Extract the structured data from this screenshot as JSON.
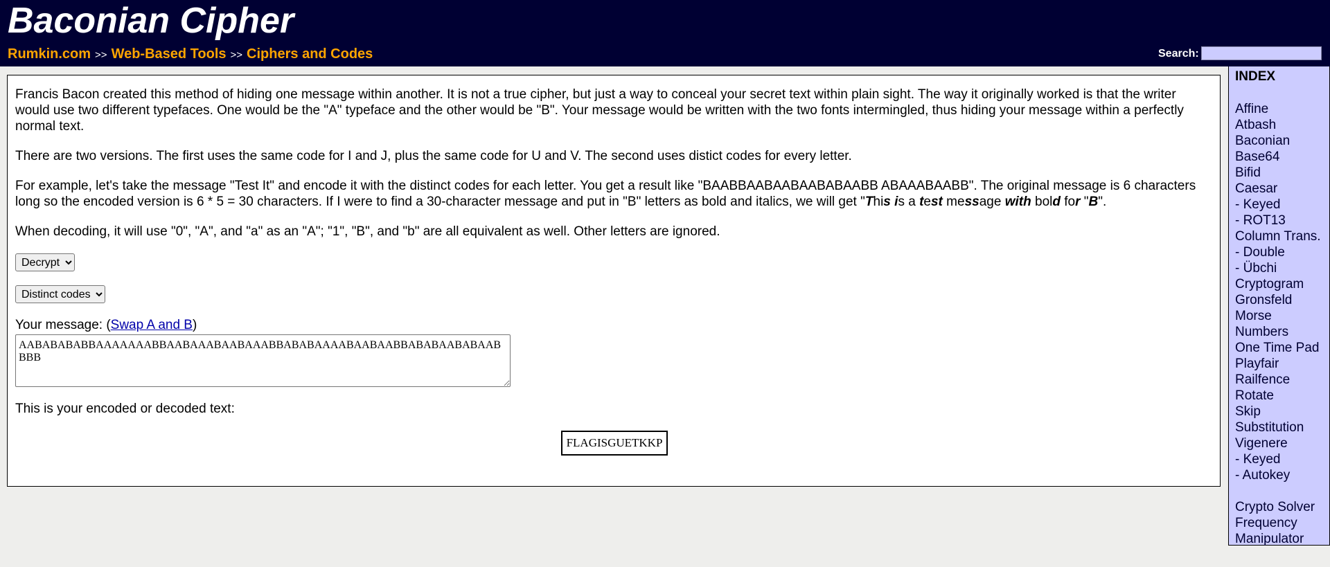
{
  "header": {
    "title": "Baconian Cipher",
    "breadcrumb": [
      "Rumkin.com",
      "Web-Based Tools",
      "Ciphers and Codes"
    ],
    "separator": ">>",
    "search_label": "Search:"
  },
  "content": {
    "para1": "Francis Bacon created this method of hiding one message within another. It is not a true cipher, but just a way to conceal your secret text within plain sight. The way it originally worked is that the writer would use two different typefaces. One would be the \"A\" typeface and the other would be \"B\". Your message would be written with the two fonts intermingled, thus hiding your message within a perfectly normal text.",
    "para2": "There are two versions. The first uses the same code for I and J, plus the same code for U and V. The second uses distict codes for every letter.",
    "para3_pre": "For example, let's take the message \"Test It\" and encode it with the distinct codes for each letter. You get a result like \"BAABBAABAABAABABAABB ABAAABAABB\". The original message is 6 characters long so the encoded version is 6 * 5 = 30 characters. If I were to find a 30-character message and put in \"B\" letters as bold and italics, we will get \"",
    "para3_post": "\".",
    "para4": "When decoding, it will use \"0\", \"A\", and \"a\" as an \"A\"; \"1\", \"B\", and \"b\" are all equivalent as well. Other letters are ignored.",
    "mode_select": {
      "selected": "Decrypt"
    },
    "codes_select": {
      "selected": "Distinct codes"
    },
    "message_label_pre": "Your message: (",
    "swap_link": "Swap A and B",
    "message_label_post": ")",
    "message_value": "AABABABABBAAAAAAABBAABAAABAABAAABBABABAAAABAABAABBABABAABABAABBBB",
    "result_label": "This is your encoded or decoded text:",
    "result_value": "FLAGISGUETKKP"
  },
  "example_segments": [
    {
      "t": "T",
      "s": "bi"
    },
    {
      "t": "h",
      "s": ""
    },
    {
      "t": "i",
      "s": ""
    },
    {
      "t": "s",
      "s": "bi"
    },
    {
      "t": " ",
      "s": ""
    },
    {
      "t": "i",
      "s": "bi"
    },
    {
      "t": "s",
      "s": ""
    },
    {
      "t": " a ",
      "s": ""
    },
    {
      "t": "t",
      "s": "bi"
    },
    {
      "t": "e",
      "s": ""
    },
    {
      "t": "st",
      "s": "bi"
    },
    {
      "t": " me",
      "s": ""
    },
    {
      "t": "ss",
      "s": "bi"
    },
    {
      "t": "a",
      "s": ""
    },
    {
      "t": "g",
      "s": ""
    },
    {
      "t": "e ",
      "s": ""
    },
    {
      "t": "with",
      "s": "bi"
    },
    {
      "t": " bol",
      "s": ""
    },
    {
      "t": "d",
      "s": "bi"
    },
    {
      "t": " fo",
      "s": ""
    },
    {
      "t": "r",
      "s": "bi"
    },
    {
      "t": " \"",
      "s": ""
    },
    {
      "t": "B",
      "s": "bi"
    }
  ],
  "index": {
    "title": "INDEX",
    "group1": [
      "Affine",
      "Atbash",
      "Baconian",
      "Base64",
      "Bifid",
      "Caesar",
      "- Keyed",
      "- ROT13",
      "Column Trans.",
      "- Double",
      "- Übchi",
      "Cryptogram",
      "Gronsfeld",
      "Morse",
      "Numbers",
      "One Time Pad",
      "Playfair",
      "Railfence",
      "Rotate",
      "Skip",
      "Substitution",
      "Vigenere",
      "- Keyed",
      "- Autokey"
    ],
    "group2": [
      "Crypto Solver",
      "Frequency",
      "Manipulator"
    ]
  }
}
